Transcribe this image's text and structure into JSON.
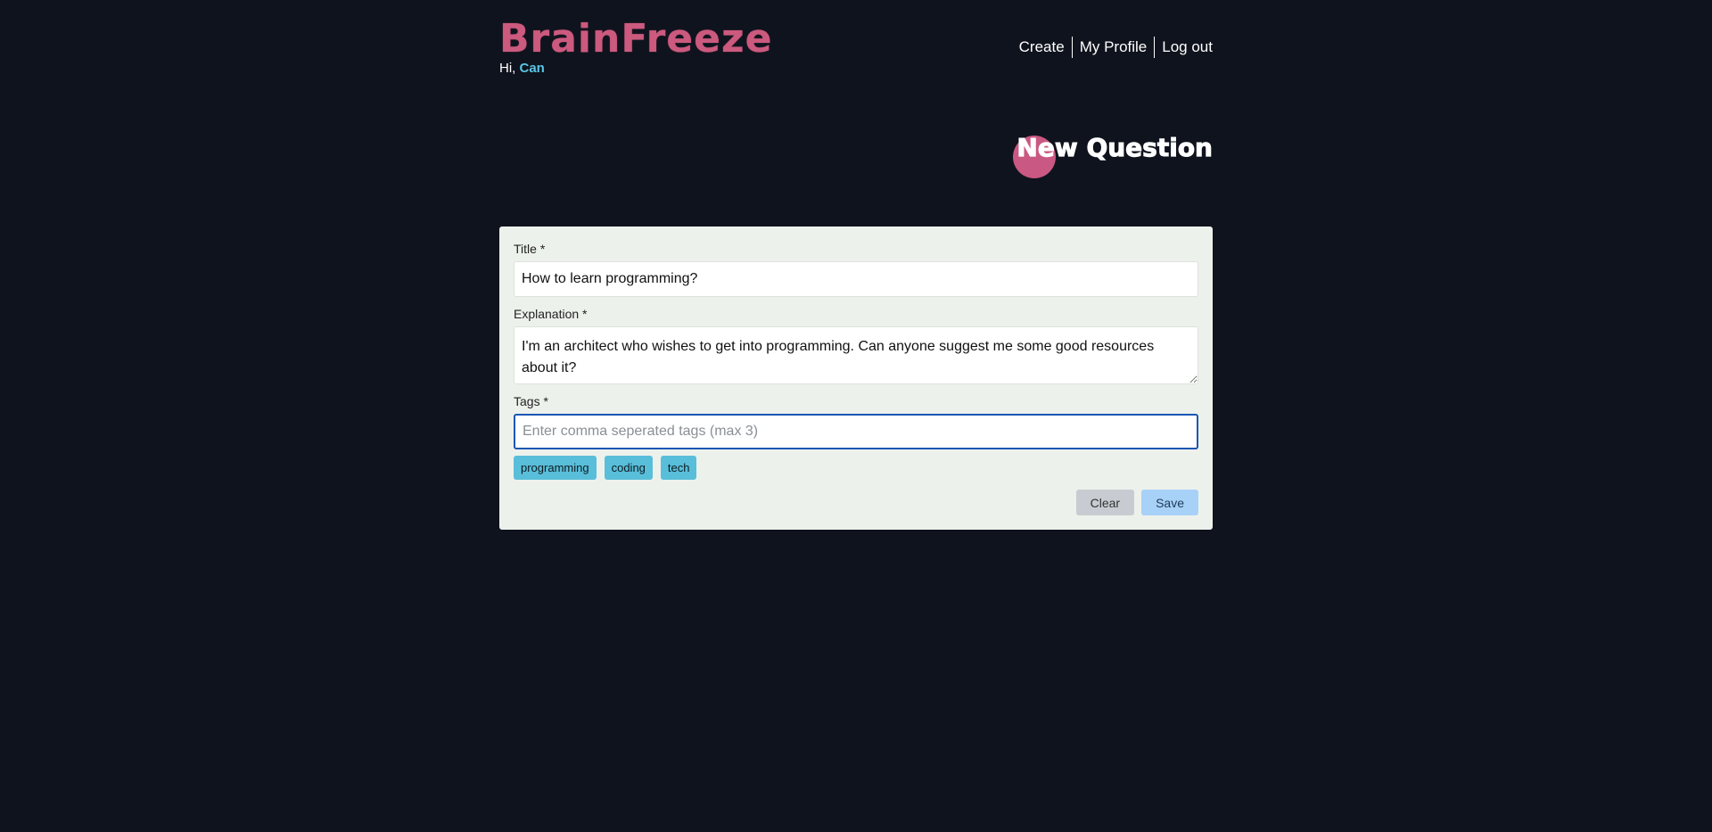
{
  "brand": {
    "logo_text": "BrainFreeze",
    "greeting_prefix": "Hi, ",
    "username": "Can"
  },
  "nav": {
    "items": [
      {
        "label": "Create"
      },
      {
        "label": "My Profile"
      },
      {
        "label": "Log out"
      }
    ]
  },
  "page": {
    "heading": "New Question"
  },
  "form": {
    "title_label": "Title *",
    "title_value": "How to learn programming?",
    "explanation_label": "Explanation *",
    "explanation_value": "I'm an architect who wishes to get into programming. Can anyone suggest me some good resources about it?",
    "tags_label": "Tags *",
    "tags_value": "",
    "tags_placeholder": "Enter comma seperated tags (max 3)",
    "tags": [
      "programming",
      "coding",
      "tech"
    ],
    "clear_label": "Clear",
    "save_label": "Save"
  },
  "colors": {
    "background": "#0f131d",
    "brand": "#cb5a7e",
    "accent": "#58c6e6",
    "card": "#edf1ec",
    "tag": "#59bed9",
    "save_button": "#a8d1f7",
    "clear_button": "#c8ccd2"
  }
}
